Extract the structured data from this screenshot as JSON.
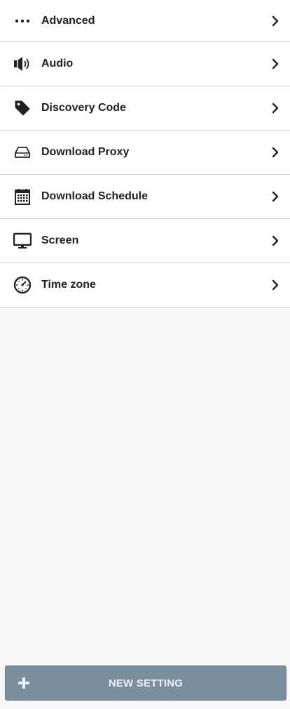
{
  "settings": {
    "items": [
      {
        "label": "Advanced",
        "icon": "ellipsis-icon"
      },
      {
        "label": "Audio",
        "icon": "speaker-icon"
      },
      {
        "label": "Discovery Code",
        "icon": "tag-icon"
      },
      {
        "label": "Download Proxy",
        "icon": "hard-drive-icon"
      },
      {
        "label": "Download Schedule",
        "icon": "calendar-icon"
      },
      {
        "label": "Screen",
        "icon": "monitor-icon"
      },
      {
        "label": "Time zone",
        "icon": "clock-icon"
      }
    ]
  },
  "actions": {
    "new_setting_label": "NEW SETTING",
    "new_setting_icon": "plus-icon"
  },
  "colors": {
    "button_bg": "#7a8f9b",
    "list_bg": "#ffffff",
    "page_bg": "#f8f8f8",
    "divider": "#cfcfcf"
  }
}
